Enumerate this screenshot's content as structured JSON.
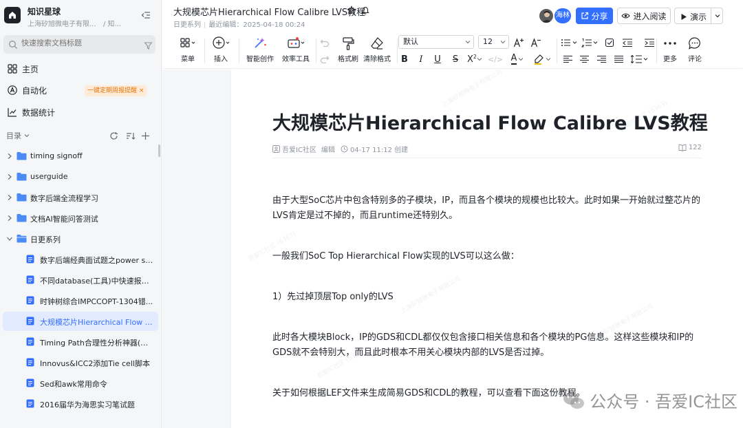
{
  "workspace": {
    "name": "知识星球",
    "org": "上海矽旭微电子有限...",
    "org_tail": "/ 知..."
  },
  "search": {
    "placeholder": "快速搜索文档标题"
  },
  "nav": {
    "home": "主页",
    "automation": "自动化",
    "automation_tag": "一键定期周报提醒 ×",
    "stats": "数据统计"
  },
  "directory": {
    "label": "目录"
  },
  "tree": {
    "folders": [
      {
        "label": "timing signoff"
      },
      {
        "label": "userguide"
      },
      {
        "label": "数字后端全流程学习"
      },
      {
        "label": "文档AI智能问答测试"
      },
      {
        "label": "日更系列"
      }
    ],
    "docs": [
      {
        "label": "数字后端经典面试题之power sw..."
      },
      {
        "label": "不同database(工具)中快速报出..."
      },
      {
        "label": "时钟树综合IMPCCOPT-1304错..."
      },
      {
        "label": "大规模芯片Hierarchical Flow C..."
      },
      {
        "label": "Timing Path合理性分析神器(低..."
      },
      {
        "label": "Innovus&ICC2添加Tie cell脚本"
      },
      {
        "label": "Sed和awk常用命令"
      },
      {
        "label": "2016届华为海思实习笔试题"
      }
    ]
  },
  "header": {
    "title": "大规模芯片Hierarchical Flow Calibre LVS教程",
    "breadcrumb_series": "日更系列",
    "last_edit": "最近编辑：2025-04-18 00:24",
    "avatar_name": "海林",
    "share": "分享",
    "reading_mode": "进入阅读",
    "present": "演示"
  },
  "toolbar": {
    "menu": "菜单",
    "insert": "插入",
    "ai_create": "智能创作",
    "efficiency": "效率工具",
    "format_painter": "格式刷",
    "clear_format": "清除格式",
    "font": "默认",
    "font_size": "12",
    "more": "更多",
    "comment": "评论"
  },
  "document": {
    "title": "大规模芯片Hierarchical Flow Calibre LVS教程",
    "author": "吾爱IC社区",
    "author_action": "编辑",
    "created": "04-17 11:12 创建",
    "views": "122",
    "paragraphs": [
      "由于大型SoC芯片中包含特别多的子模块，IP，而且各个模块的规模也比较大。此时如果一开始就过整芯片的LVS肯定是过不掉的，而且runtime还特别久。",
      "一般我们SoC Top Hierarchical Flow实现的LVS可以这么做：",
      "1）先过掉顶层Top only的LVS",
      "此时各大模块Block，IP的GDS和CDL都仅仅包含接口相关信息和各个模块的PG信息。这样这些模块和IP的GDS就不会特别大，而且此时根本不用关心模块内部的LVS是否过掉。",
      "关于如何根据LEF文件来生成简易GDS和CDL的教程，可以查看下面这份教程。"
    ]
  },
  "watermark": {
    "company": "上海矽旭微电子有限公司",
    "community": "吾爱IC社区 (6363)"
  },
  "wechat_badge": "公众号 · 吾爱IC社区",
  "colors": {
    "accent": "#3370ff",
    "tag_bg": "#fdebd8",
    "tag_text": "#e5760e",
    "folder": "#4c8bf5"
  }
}
